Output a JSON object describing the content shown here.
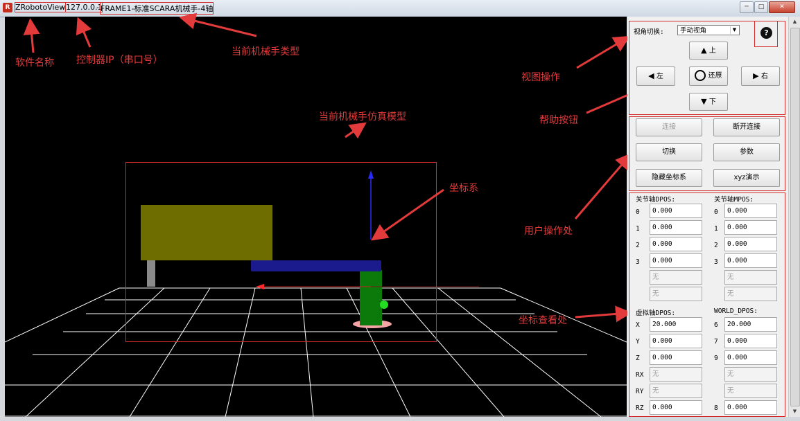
{
  "window": {
    "app_name": "ZRobotoView",
    "controller_ip": "127.0.0.1",
    "robot_type": "FRAME1-标准SCARA机械手-4轴",
    "minimize": "─",
    "maximize": "□",
    "close": "✕"
  },
  "view_control": {
    "label": "视角切换:",
    "select_value": "手动视角",
    "up": "上",
    "left": "左",
    "reset": "还原",
    "right": "右",
    "down": "下"
  },
  "actions": {
    "connect": "连接",
    "disconnect": "断开连接",
    "switch": "切换",
    "params": "参数",
    "hide_coords": "隐藏坐标系",
    "xyz_demo": "xyz演示"
  },
  "coords": {
    "joint_dpos_label": "关节轴DPOS:",
    "joint_mpos_label": "关节轴MPOS:",
    "joint_dpos": [
      {
        "idx": "0",
        "val": "0.000"
      },
      {
        "idx": "1",
        "val": "0.000"
      },
      {
        "idx": "2",
        "val": "0.000"
      },
      {
        "idx": "3",
        "val": "0.000"
      },
      {
        "idx": "",
        "val": "无"
      },
      {
        "idx": "",
        "val": "无"
      }
    ],
    "joint_mpos": [
      {
        "idx": "0",
        "val": "0.000"
      },
      {
        "idx": "1",
        "val": "0.000"
      },
      {
        "idx": "2",
        "val": "0.000"
      },
      {
        "idx": "3",
        "val": "0.000"
      },
      {
        "idx": "",
        "val": "无"
      },
      {
        "idx": "",
        "val": "无"
      }
    ],
    "virtual_dpos_label": "虚拟轴DPOS:",
    "world_dpos_label": "WORLD_DPOS:",
    "virtual_dpos": [
      {
        "idx": "X",
        "val": "20.000"
      },
      {
        "idx": "Y",
        "val": "0.000"
      },
      {
        "idx": "Z",
        "val": "0.000"
      },
      {
        "idx": "RX",
        "val": "无"
      },
      {
        "idx": "RY",
        "val": "无"
      },
      {
        "idx": "RZ",
        "val": "0.000"
      }
    ],
    "world_dpos": [
      {
        "idx": "6",
        "val": "20.000"
      },
      {
        "idx": "7",
        "val": "0.000"
      },
      {
        "idx": "9",
        "val": "0.000"
      },
      {
        "idx": "",
        "val": "无"
      },
      {
        "idx": "",
        "val": "无"
      },
      {
        "idx": "8",
        "val": "0.000"
      }
    ]
  },
  "annotations": {
    "software_name": "软件名称",
    "controller_ip": "控制器IP（串口号）",
    "robot_type": "当前机械手类型",
    "sim_model": "当前机械手仿真模型",
    "coord_system": "坐标系",
    "view_ops": "视图操作",
    "help_button": "帮助按钮",
    "user_ops": "用户操作处",
    "coord_view": "坐标查看处"
  },
  "colors": {
    "accent_red": "#e33b3b",
    "viewport": "#000000",
    "base_green": "#0b7a0b",
    "arm_blue": "#1b1b8e",
    "table_olive": "#6e6e00"
  }
}
